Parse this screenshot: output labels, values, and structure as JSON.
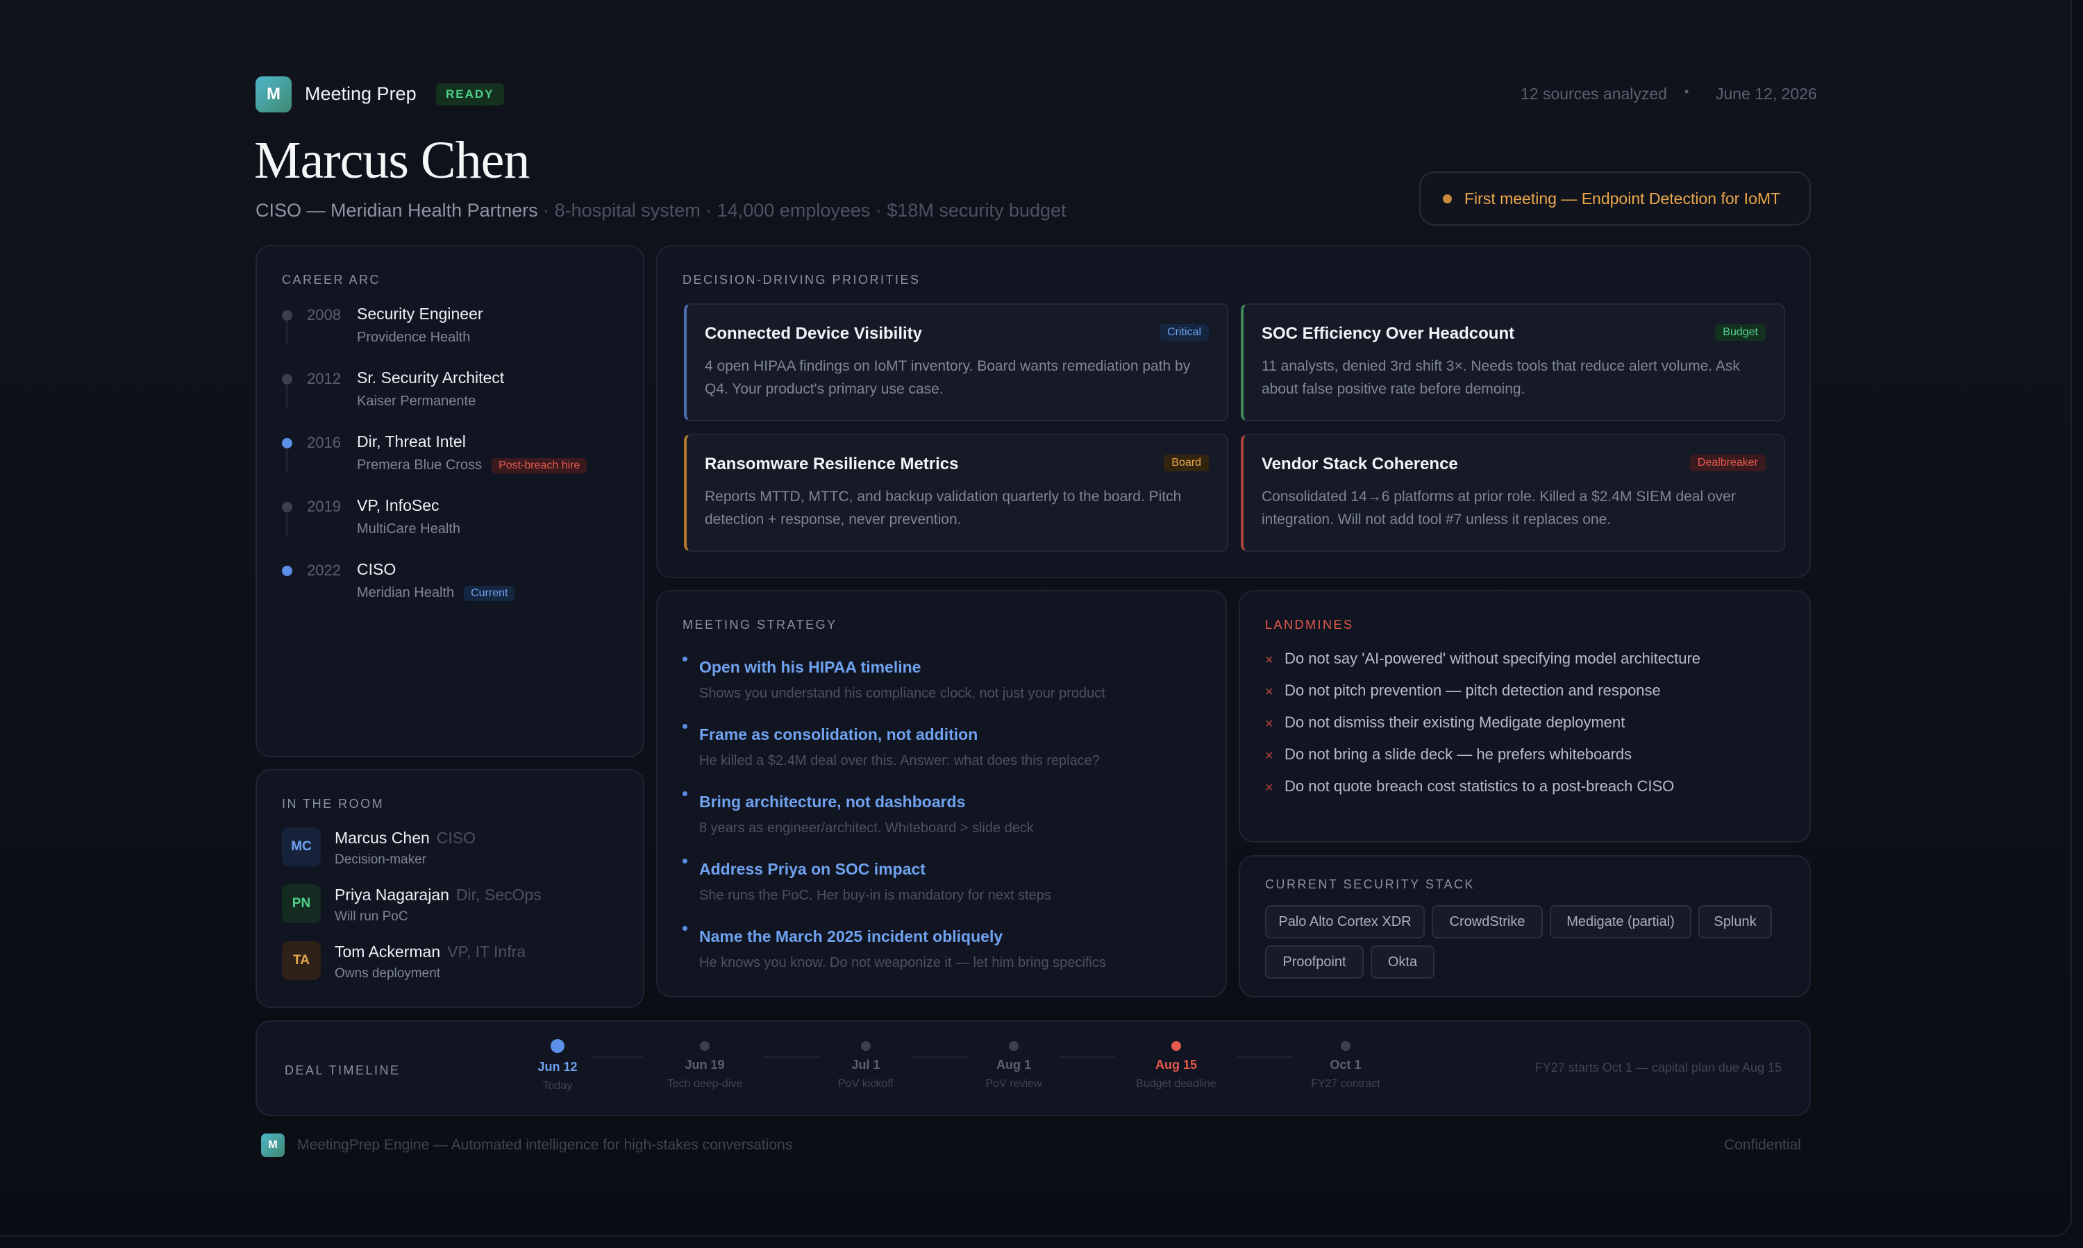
{
  "header": {
    "logo_letter": "M",
    "app_title": "Meeting Prep",
    "status": "READY",
    "sources": "12 sources analyzed",
    "separator": "•",
    "date": "June 12, 2026"
  },
  "profile": {
    "name": "Marcus Chen",
    "role": "CISO — Meridian Health Partners",
    "details": " · 8-hospital system · 14,000 employees · $18M security budget",
    "meeting_pill": "First meeting — Endpoint Detection for IoMT"
  },
  "career": {
    "label": "CAREER ARC",
    "items": [
      {
        "year": "2008",
        "title": "Security Engineer",
        "org": "Providence Health",
        "badge": ""
      },
      {
        "year": "2012",
        "title": "Sr. Security Architect",
        "org": "Kaiser Permanente",
        "badge": ""
      },
      {
        "year": "2016",
        "title": "Dir, Threat Intel",
        "org": "Premera Blue Cross",
        "badge": "Post-breach hire"
      },
      {
        "year": "2019",
        "title": "VP, InfoSec",
        "org": "MultiCare Health",
        "badge": ""
      },
      {
        "year": "2022",
        "title": "CISO",
        "org": "Meridian Health",
        "badge": "Current"
      }
    ]
  },
  "room": {
    "label": "IN THE ROOM",
    "people": [
      {
        "initials": "MC",
        "name": "Marcus Chen",
        "title": "CISO",
        "role": "Decision-maker"
      },
      {
        "initials": "PN",
        "name": "Priya Nagarajan",
        "title": "Dir, SecOps",
        "role": "Will run PoC"
      },
      {
        "initials": "TA",
        "name": "Tom Ackerman",
        "title": "VP, IT Infra",
        "role": "Owns deployment"
      }
    ]
  },
  "priorities": {
    "label": "DECISION-DRIVING PRIORITIES",
    "items": [
      {
        "title": "Connected Device Visibility",
        "tag": "Critical",
        "text": "4 open HIPAA findings on IoMT inventory. Board wants remediation path by Q4. Your product's primary use case."
      },
      {
        "title": "SOC Efficiency Over Headcount",
        "tag": "Budget",
        "text": "11 analysts, denied 3rd shift 3×. Needs tools that reduce alert volume. Ask about false positive rate before demoing."
      },
      {
        "title": "Ransomware Resilience Metrics",
        "tag": "Board",
        "text": "Reports MTTD, MTTC, and backup validation quarterly to the board. Pitch detection + response, never prevention."
      },
      {
        "title": "Vendor Stack Coherence",
        "tag": "Dealbreaker",
        "text": "Consolidated 14→6 platforms at prior role. Killed a $2.4M SIEM deal over integration. Will not add tool #7 unless it replaces one."
      }
    ]
  },
  "strategy": {
    "label": "MEETING STRATEGY",
    "items": [
      {
        "title": "Open with his HIPAA timeline",
        "sub": "Shows you understand his compliance clock, not just your product"
      },
      {
        "title": "Frame as consolidation, not addition",
        "sub": "He killed a $2.4M deal over this. Answer: what does this replace?"
      },
      {
        "title": "Bring architecture, not dashboards",
        "sub": "8 years as engineer/architect. Whiteboard > slide deck"
      },
      {
        "title": "Address Priya on SOC impact",
        "sub": "She runs the PoC. Her buy-in is mandatory for next steps"
      },
      {
        "title": "Name the March 2025 incident obliquely",
        "sub": "He knows you know. Do not weaponize it — let him bring specifics"
      }
    ]
  },
  "landmines": {
    "label": "LANDMINES",
    "icon": "×",
    "items": [
      "Do not say 'AI-powered' without specifying model architecture",
      "Do not pitch prevention — pitch detection and response",
      "Do not dismiss their existing Medigate deployment",
      "Do not bring a slide deck — he prefers whiteboards",
      "Do not quote breach cost statistics to a post-breach CISO"
    ]
  },
  "stack": {
    "label": "CURRENT SECURITY STACK",
    "items": [
      "Palo Alto Cortex XDR",
      "CrowdStrike",
      "Medigate (partial)",
      "Splunk",
      "Proofpoint",
      "Okta"
    ]
  },
  "deal": {
    "label": "DEAL TIMELINE",
    "milestones": [
      {
        "date": "Jun 12",
        "desc": "Today"
      },
      {
        "date": "Jun 19",
        "desc": "Tech deep-dive"
      },
      {
        "date": "Jul 1",
        "desc": "PoV kickoff"
      },
      {
        "date": "Aug 1",
        "desc": "PoV review"
      },
      {
        "date": "Aug 15",
        "desc": "Budget deadline"
      },
      {
        "date": "Oct 1",
        "desc": "FY27 contract"
      }
    ],
    "note": "FY27 starts Oct 1 — capital plan due Aug 15"
  },
  "footer": {
    "logo_letter": "M",
    "text": "MeetingPrep Engine — Automated intelligence for high-stakes conversations",
    "right": "Confidential"
  },
  "colors": {
    "accent_blue": "#6fa2f0",
    "accent_green": "#4fd18b",
    "accent_orange": "#eaa84c",
    "accent_red": "#e45a4c",
    "background": "#0b0e16"
  }
}
